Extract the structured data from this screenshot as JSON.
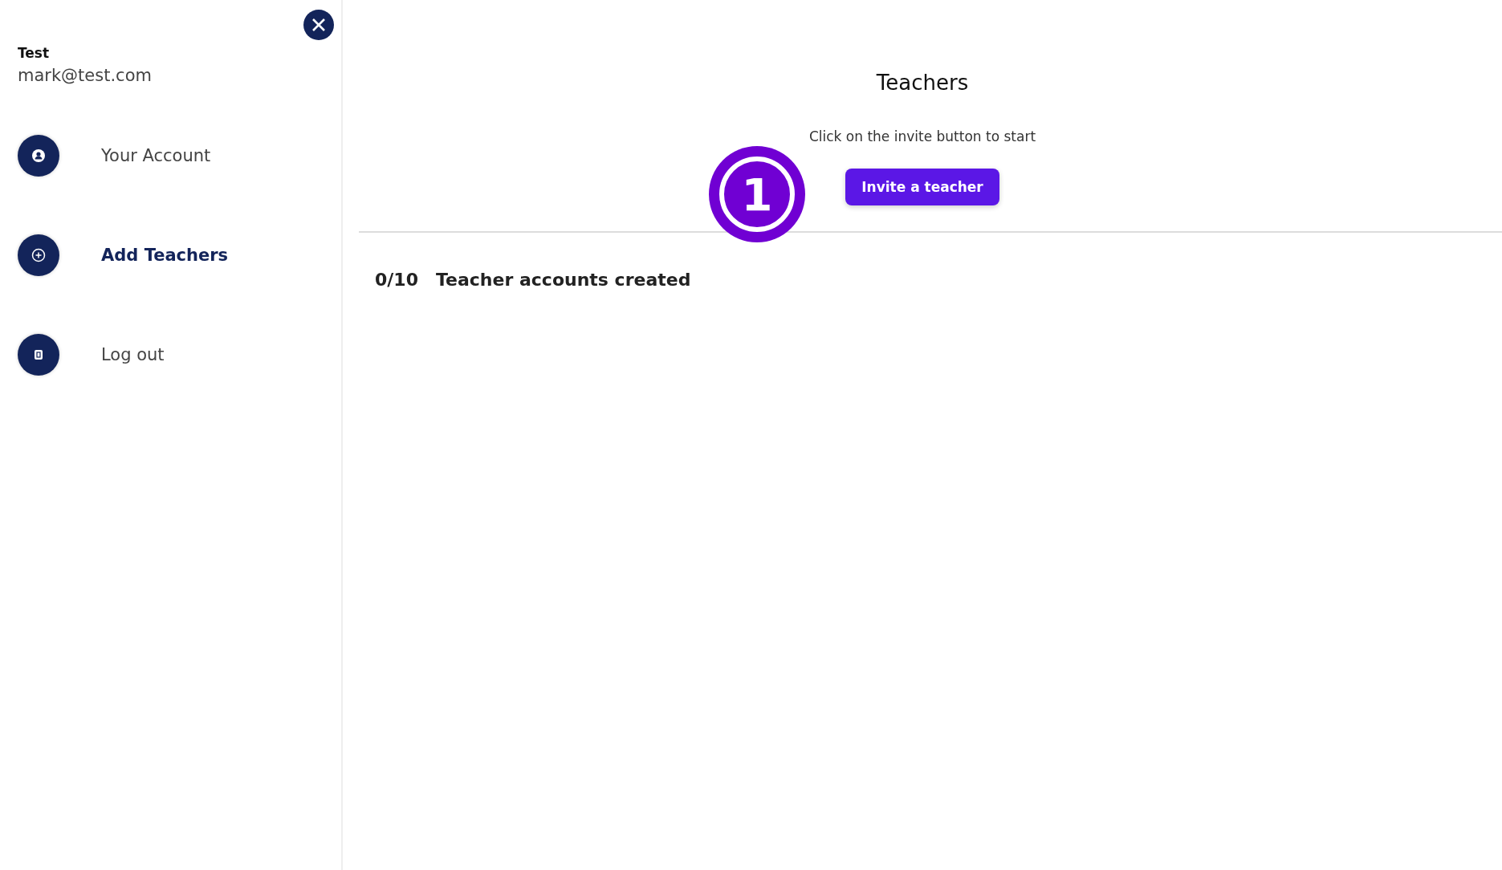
{
  "sidebar": {
    "user": {
      "name": "Test",
      "email": "mark@test.com"
    },
    "items": [
      {
        "label": "Your Account",
        "kind": "person",
        "selected": false
      },
      {
        "label": "Add Teachers",
        "kind": "plus",
        "selected": true
      },
      {
        "label": "Log out",
        "kind": "logout",
        "selected": false
      }
    ]
  },
  "main": {
    "title": "Teachers",
    "hint": "Click on the invite button to start",
    "button": "Invite a teacher",
    "count": "0/10",
    "count_label": "Teacher accounts created"
  },
  "step_marker": "1"
}
